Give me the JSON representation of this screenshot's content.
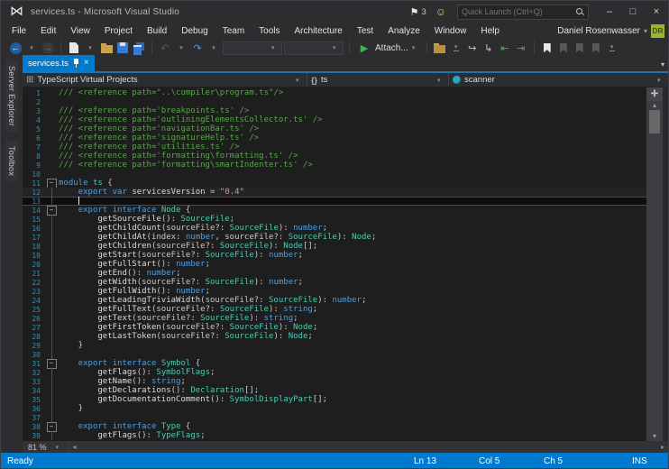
{
  "colors": {
    "accent": "#007acc",
    "chrome": "#2d2d30",
    "editor_bg": "#1e1e1e",
    "comment": "#57a64a",
    "keyword": "#569cd6",
    "type": "#4ec9b0",
    "string": "#d69d85",
    "line_number": "#2b91af",
    "active_tab": "#007acc",
    "avatar_bg": "#9ab62c"
  },
  "titlebar": {
    "title": "services.ts - Microsoft Visual Studio",
    "notification_count": "3",
    "quick_launch_placeholder": "Quick Launch (Ctrl+Q)"
  },
  "menu": {
    "items": [
      "File",
      "Edit",
      "View",
      "Project",
      "Build",
      "Debug",
      "Team",
      "Tools",
      "Architecture",
      "Test",
      "Analyze",
      "Window",
      "Help"
    ]
  },
  "account": {
    "name": "Daniel Rosenwasser",
    "initials": "DR"
  },
  "toolbar": {
    "attach_label": "Attach..."
  },
  "sidebar": {
    "tabs": [
      "Server Explorer",
      "Toolbox"
    ]
  },
  "tabs": {
    "active_label": "services.ts"
  },
  "navbar": {
    "project": "TypeScript Virtual Projects",
    "scope": "ts",
    "member": "scanner"
  },
  "icons": {
    "logo": "⋈",
    "flag": "⚑",
    "smiley": "☺",
    "minimize": "–",
    "maximize": "□",
    "close": "×",
    "back": "←",
    "forward": "→",
    "dropdown": "▾",
    "undo": "↶",
    "redo": "↷",
    "play": "▶",
    "project": "⊞",
    "braces": "{}",
    "tab_close": "×",
    "splitter": "✛",
    "scroll_up": "▴",
    "scroll_down": "▾",
    "scroll_left": "◂",
    "scroll_right": "▸",
    "folder_arrow": "↪",
    "page_arrow": "↳",
    "indent_decrease": "⇤",
    "indent_increase": "⇥"
  },
  "editor": {
    "zoom_level": "81 %",
    "cursor": {
      "line": 13,
      "col": 5
    },
    "lines": [
      {
        "n": 1,
        "f": "",
        "s": [
          [
            "c",
            "/// <reference path=\"..\\compiler\\program.ts\"/>"
          ]
        ]
      },
      {
        "n": 2,
        "f": "",
        "s": []
      },
      {
        "n": 3,
        "f": "",
        "s": [
          [
            "c",
            "/// <reference path='breakpoints.ts' />"
          ]
        ]
      },
      {
        "n": 4,
        "f": "",
        "s": [
          [
            "c",
            "/// <reference path='outliningElementsCollector.ts' />"
          ]
        ]
      },
      {
        "n": 5,
        "f": "",
        "s": [
          [
            "c",
            "/// <reference path='navigationBar.ts' />"
          ]
        ]
      },
      {
        "n": 6,
        "f": "",
        "s": [
          [
            "c",
            "/// <reference path='signatureHelp.ts' />"
          ]
        ]
      },
      {
        "n": 7,
        "f": "",
        "s": [
          [
            "c",
            "/// <reference path='utilities.ts' />"
          ]
        ]
      },
      {
        "n": 8,
        "f": "",
        "s": [
          [
            "c",
            "/// <reference path='formatting\\formatting.ts' />"
          ]
        ]
      },
      {
        "n": 9,
        "f": "",
        "s": [
          [
            "c",
            "/// <reference path='formatting\\smartIndenter.ts' />"
          ]
        ]
      },
      {
        "n": 10,
        "f": "",
        "s": []
      },
      {
        "n": 11,
        "f": "b",
        "s": [
          [
            "k",
            "module"
          ],
          [
            "d",
            " "
          ],
          [
            "t",
            "ts"
          ],
          [
            "d",
            " {"
          ]
        ]
      },
      {
        "n": 12,
        "f": "l",
        "hl": true,
        "s": [
          [
            "d",
            "    "
          ],
          [
            "k",
            "export"
          ],
          [
            "d",
            " "
          ],
          [
            "k",
            "var"
          ],
          [
            "d",
            " "
          ],
          [
            "i",
            "servicesVersion"
          ],
          [
            "d",
            " = "
          ],
          [
            "s",
            "\"0.4\""
          ]
        ]
      },
      {
        "n": 13,
        "f": "l",
        "cur": true,
        "s": []
      },
      {
        "n": 14,
        "f": "b",
        "s": [
          [
            "d",
            "    "
          ],
          [
            "k",
            "export"
          ],
          [
            "d",
            " "
          ],
          [
            "k",
            "interface"
          ],
          [
            "d",
            " "
          ],
          [
            "t",
            "Node"
          ],
          [
            "d",
            " {"
          ]
        ]
      },
      {
        "n": 15,
        "f": "l",
        "s": [
          [
            "d",
            "        "
          ],
          [
            "i",
            "getSourceFile"
          ],
          [
            "d",
            "(): "
          ],
          [
            "t",
            "SourceFile"
          ],
          [
            "d",
            ";"
          ]
        ]
      },
      {
        "n": 16,
        "f": "l",
        "s": [
          [
            "d",
            "        "
          ],
          [
            "i",
            "getChildCount"
          ],
          [
            "d",
            "(sourceFile?: "
          ],
          [
            "t",
            "SourceFile"
          ],
          [
            "d",
            "): "
          ],
          [
            "k",
            "number"
          ],
          [
            "d",
            ";"
          ]
        ]
      },
      {
        "n": 17,
        "f": "l",
        "s": [
          [
            "d",
            "        "
          ],
          [
            "i",
            "getChildAt"
          ],
          [
            "d",
            "(index: "
          ],
          [
            "k",
            "number"
          ],
          [
            "d",
            ", sourceFile?: "
          ],
          [
            "t",
            "SourceFile"
          ],
          [
            "d",
            "): "
          ],
          [
            "t",
            "Node"
          ],
          [
            "d",
            ";"
          ]
        ]
      },
      {
        "n": 18,
        "f": "l",
        "s": [
          [
            "d",
            "        "
          ],
          [
            "i",
            "getChildren"
          ],
          [
            "d",
            "(sourceFile?: "
          ],
          [
            "t",
            "SourceFile"
          ],
          [
            "d",
            "): "
          ],
          [
            "t",
            "Node"
          ],
          [
            "d",
            "[];"
          ]
        ]
      },
      {
        "n": 19,
        "f": "l",
        "s": [
          [
            "d",
            "        "
          ],
          [
            "i",
            "getStart"
          ],
          [
            "d",
            "(sourceFile?: "
          ],
          [
            "t",
            "SourceFile"
          ],
          [
            "d",
            "): "
          ],
          [
            "k",
            "number"
          ],
          [
            "d",
            ";"
          ]
        ]
      },
      {
        "n": 20,
        "f": "l",
        "s": [
          [
            "d",
            "        "
          ],
          [
            "i",
            "getFullStart"
          ],
          [
            "d",
            "(): "
          ],
          [
            "k",
            "number"
          ],
          [
            "d",
            ";"
          ]
        ]
      },
      {
        "n": 21,
        "f": "l",
        "s": [
          [
            "d",
            "        "
          ],
          [
            "i",
            "getEnd"
          ],
          [
            "d",
            "(): "
          ],
          [
            "k",
            "number"
          ],
          [
            "d",
            ";"
          ]
        ]
      },
      {
        "n": 22,
        "f": "l",
        "s": [
          [
            "d",
            "        "
          ],
          [
            "i",
            "getWidth"
          ],
          [
            "d",
            "(sourceFile?: "
          ],
          [
            "t",
            "SourceFile"
          ],
          [
            "d",
            "): "
          ],
          [
            "k",
            "number"
          ],
          [
            "d",
            ";"
          ]
        ]
      },
      {
        "n": 23,
        "f": "l",
        "s": [
          [
            "d",
            "        "
          ],
          [
            "i",
            "getFullWidth"
          ],
          [
            "d",
            "(): "
          ],
          [
            "k",
            "number"
          ],
          [
            "d",
            ";"
          ]
        ]
      },
      {
        "n": 24,
        "f": "l",
        "s": [
          [
            "d",
            "        "
          ],
          [
            "i",
            "getLeadingTriviaWidth"
          ],
          [
            "d",
            "(sourceFile?: "
          ],
          [
            "t",
            "SourceFile"
          ],
          [
            "d",
            "): "
          ],
          [
            "k",
            "number"
          ],
          [
            "d",
            ";"
          ]
        ]
      },
      {
        "n": 25,
        "f": "l",
        "s": [
          [
            "d",
            "        "
          ],
          [
            "i",
            "getFullText"
          ],
          [
            "d",
            "(sourceFile?: "
          ],
          [
            "t",
            "SourceFile"
          ],
          [
            "d",
            "): "
          ],
          [
            "k",
            "string"
          ],
          [
            "d",
            ";"
          ]
        ]
      },
      {
        "n": 26,
        "f": "l",
        "s": [
          [
            "d",
            "        "
          ],
          [
            "i",
            "getText"
          ],
          [
            "d",
            "(sourceFile?: "
          ],
          [
            "t",
            "SourceFile"
          ],
          [
            "d",
            "): "
          ],
          [
            "k",
            "string"
          ],
          [
            "d",
            ";"
          ]
        ]
      },
      {
        "n": 27,
        "f": "l",
        "s": [
          [
            "d",
            "        "
          ],
          [
            "i",
            "getFirstToken"
          ],
          [
            "d",
            "(sourceFile?: "
          ],
          [
            "t",
            "SourceFile"
          ],
          [
            "d",
            "): "
          ],
          [
            "t",
            "Node"
          ],
          [
            "d",
            ";"
          ]
        ]
      },
      {
        "n": 28,
        "f": "l",
        "s": [
          [
            "d",
            "        "
          ],
          [
            "i",
            "getLastToken"
          ],
          [
            "d",
            "(sourceFile?: "
          ],
          [
            "t",
            "SourceFile"
          ],
          [
            "d",
            "): "
          ],
          [
            "t",
            "Node"
          ],
          [
            "d",
            ";"
          ]
        ]
      },
      {
        "n": 29,
        "f": "l",
        "s": [
          [
            "d",
            "    }"
          ]
        ]
      },
      {
        "n": 30,
        "f": "l",
        "s": []
      },
      {
        "n": 31,
        "f": "b",
        "s": [
          [
            "d",
            "    "
          ],
          [
            "k",
            "export"
          ],
          [
            "d",
            " "
          ],
          [
            "k",
            "interface"
          ],
          [
            "d",
            " "
          ],
          [
            "t",
            "Symbol"
          ],
          [
            "d",
            " {"
          ]
        ]
      },
      {
        "n": 32,
        "f": "l",
        "s": [
          [
            "d",
            "        "
          ],
          [
            "i",
            "getFlags"
          ],
          [
            "d",
            "(): "
          ],
          [
            "t",
            "SymbolFlags"
          ],
          [
            "d",
            ";"
          ]
        ]
      },
      {
        "n": 33,
        "f": "l",
        "s": [
          [
            "d",
            "        "
          ],
          [
            "i",
            "getName"
          ],
          [
            "d",
            "(): "
          ],
          [
            "k",
            "string"
          ],
          [
            "d",
            ";"
          ]
        ]
      },
      {
        "n": 34,
        "f": "l",
        "s": [
          [
            "d",
            "        "
          ],
          [
            "i",
            "getDeclarations"
          ],
          [
            "d",
            "(): "
          ],
          [
            "t",
            "Declaration"
          ],
          [
            "d",
            "[];"
          ]
        ]
      },
      {
        "n": 35,
        "f": "l",
        "s": [
          [
            "d",
            "        "
          ],
          [
            "i",
            "getDocumentationComment"
          ],
          [
            "d",
            "(): "
          ],
          [
            "t",
            "SymbolDisplayPart"
          ],
          [
            "d",
            "[];"
          ]
        ]
      },
      {
        "n": 36,
        "f": "l",
        "s": [
          [
            "d",
            "    }"
          ]
        ]
      },
      {
        "n": 37,
        "f": "l",
        "s": []
      },
      {
        "n": 38,
        "f": "b",
        "s": [
          [
            "d",
            "    "
          ],
          [
            "k",
            "export"
          ],
          [
            "d",
            " "
          ],
          [
            "k",
            "interface"
          ],
          [
            "d",
            " "
          ],
          [
            "t",
            "Type"
          ],
          [
            "d",
            " {"
          ]
        ]
      },
      {
        "n": 39,
        "f": "l",
        "s": [
          [
            "d",
            "        "
          ],
          [
            "i",
            "getFlags"
          ],
          [
            "d",
            "(): "
          ],
          [
            "t",
            "TypeFlags"
          ],
          [
            "d",
            ";"
          ]
        ]
      }
    ]
  },
  "statusbar": {
    "state": "Ready",
    "line": "Ln 13",
    "column": "Col 5",
    "character": "Ch 5",
    "mode": "INS"
  }
}
